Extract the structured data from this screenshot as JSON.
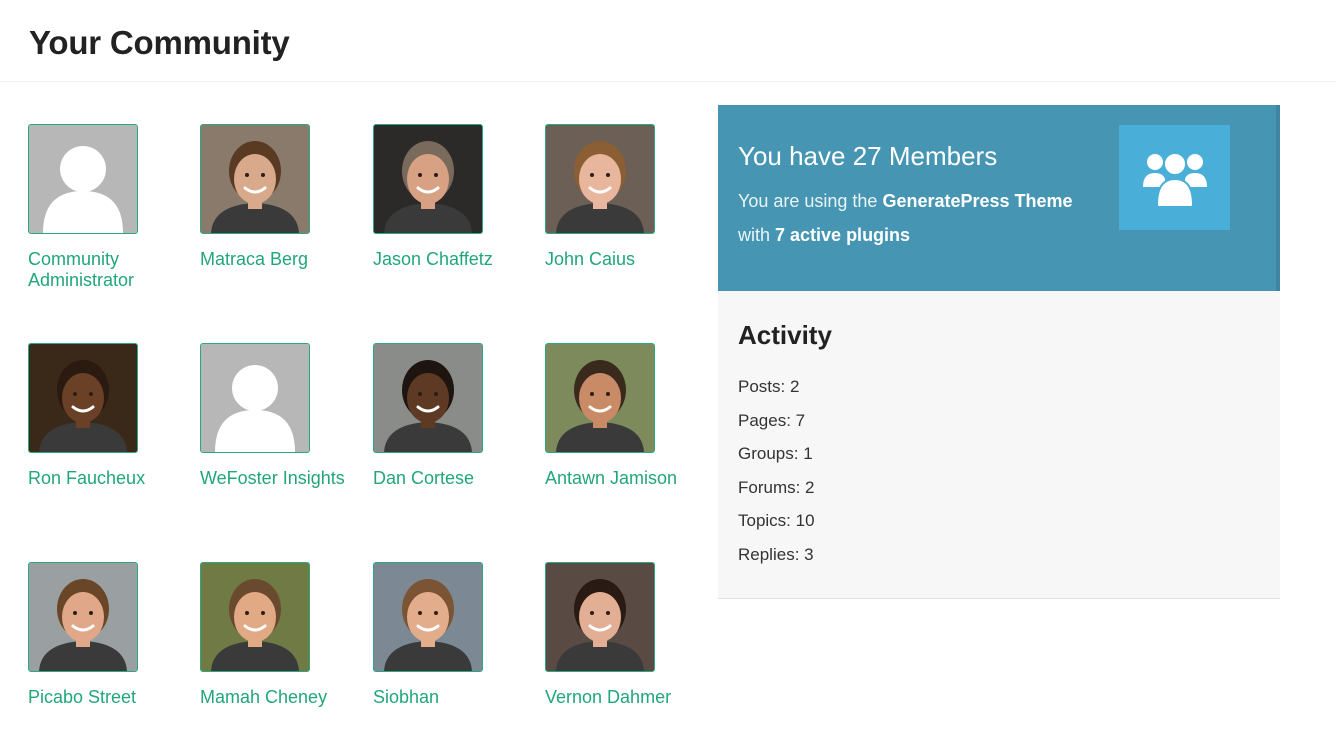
{
  "page_title": "Your Community",
  "members": [
    {
      "name": "Community Administrator",
      "avatar": "placeholder"
    },
    {
      "name": "Matraca Berg",
      "avatar": "photo",
      "skin": "#d8a98a",
      "hair": "#5a3a22",
      "bg": "#8a7a6c"
    },
    {
      "name": "Jason Chaffetz",
      "avatar": "photo",
      "skin": "#d9a184",
      "hair": "#7a6a5c",
      "bg": "#2b2a28"
    },
    {
      "name": "John Caius",
      "avatar": "photo",
      "skin": "#e7b69d",
      "hair": "#8b5e34",
      "bg": "#6c6056"
    },
    {
      "name": "Ron Faucheux",
      "avatar": "photo",
      "skin": "#6a4026",
      "hair": "#2a1a10",
      "bg": "#3a2818"
    },
    {
      "name": "WeFoster Insights",
      "avatar": "placeholder"
    },
    {
      "name": "Dan Cortese",
      "avatar": "photo",
      "skin": "#5e3a24",
      "hair": "#1e1410",
      "bg": "#8a8c8a"
    },
    {
      "name": "Antawn Jamison",
      "avatar": "photo",
      "skin": "#c98a66",
      "hair": "#3a2a1e",
      "bg": "#7d8b5c"
    },
    {
      "name": "Picabo Street",
      "avatar": "photo",
      "skin": "#e0a888",
      "hair": "#6a4628",
      "bg": "#9aa0a2"
    },
    {
      "name": "Mamah Cheney",
      "avatar": "photo",
      "skin": "#e1aa84",
      "hair": "#6a4a2e",
      "bg": "#6f7a44"
    },
    {
      "name": "Siobhan",
      "avatar": "photo",
      "skin": "#e3ad8c",
      "hair": "#7a5434",
      "bg": "#7c8894"
    },
    {
      "name": "Vernon Dahmer",
      "avatar": "photo",
      "skin": "#e2ae94",
      "hair": "#2a1a14",
      "bg": "#5a4a44"
    }
  ],
  "stats": {
    "title": "You have 27 Members",
    "line1_prefix": "You are using the ",
    "line1_bold": "GeneratePress Theme",
    "line2_prefix": "with ",
    "line2_bold": "7 active plugins",
    "icon": "users-group-icon"
  },
  "activity": {
    "title": "Activity",
    "items": [
      "Posts: 2",
      "Pages: 7",
      "Groups: 1",
      "Forums: 2",
      "Topics: 10",
      "Replies: 3"
    ]
  },
  "colors": {
    "accent_green": "#21a67a",
    "stats_blue": "#4696b3",
    "icon_box_blue": "#4aafd8",
    "placeholder_gray": "#b7b7b7"
  }
}
